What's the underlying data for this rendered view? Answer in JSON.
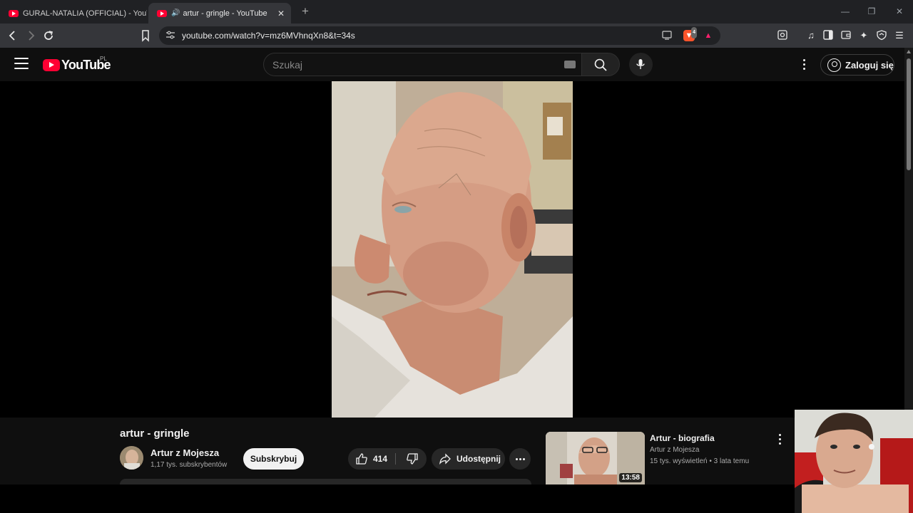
{
  "browser": {
    "tabs": [
      {
        "title": "GURAL-NATALIA (OFFICIAL) - YouTube",
        "active": false
      },
      {
        "title": "artur - gringle - YouTube",
        "active": true
      }
    ],
    "url": "youtube.com/watch?v=mz6MVhnqXn8&t=34s",
    "brave_badge": "4"
  },
  "youtube": {
    "logo_text": "YouTube",
    "region": "PL",
    "search_placeholder": "Szukaj",
    "signin_label": "Zaloguj się"
  },
  "video": {
    "title": "artur - gringle",
    "channel": "Artur z Mojesza",
    "subscribers": "1,17 tys. subskrybentów",
    "subscribe_label": "Subskrybuj",
    "likes": "414",
    "share_label": "Udostępnij"
  },
  "related": [
    {
      "title": "Artur - biografia",
      "channel": "Artur z Mojesza",
      "views": "15 tys. wyświetleń",
      "age": "3 lata temu",
      "duration": "13:58"
    }
  ],
  "colors": {
    "yt_red": "#ff0033",
    "background": "#0f0f0f",
    "chip": "#272727"
  },
  "icons": [
    "youtube-favicon-icon",
    "speaker-icon",
    "close-icon",
    "plus-icon",
    "back-icon",
    "forward-icon",
    "reload-icon",
    "bookmark-icon",
    "site-settings-icon",
    "cast-icon",
    "brave-shields-icon",
    "brave-rewards-icon",
    "screenshot-icon",
    "music-icon",
    "sidebar-icon",
    "wallet-icon",
    "leo-icon",
    "vpn-icon",
    "menu-icon",
    "search-icon",
    "mic-icon",
    "keyboard-icon",
    "account-icon",
    "like-icon",
    "dislike-icon",
    "share-icon"
  ]
}
